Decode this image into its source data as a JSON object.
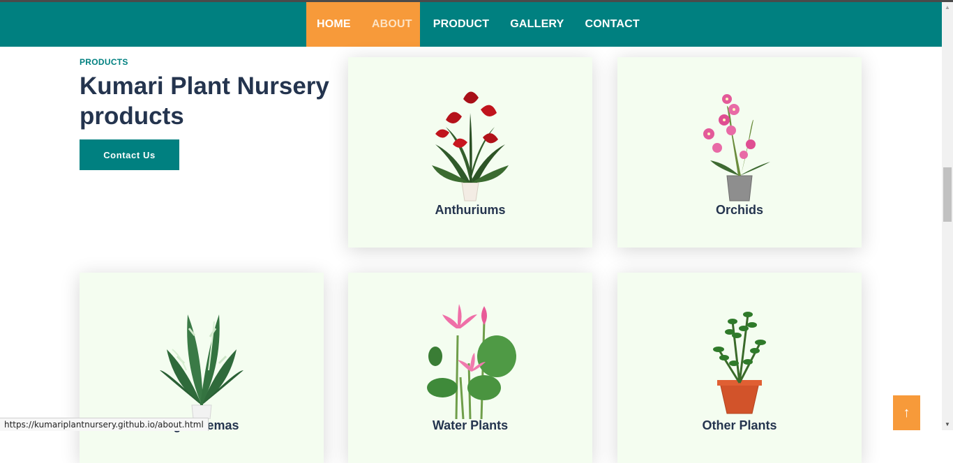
{
  "nav": {
    "items": [
      {
        "label": "HOME",
        "active": false
      },
      {
        "label": "ABOUT",
        "active": true
      },
      {
        "label": "PRODUCT",
        "active": false
      },
      {
        "label": "GALLERY",
        "active": false
      },
      {
        "label": "CONTACT",
        "active": false
      }
    ]
  },
  "section": {
    "eyebrow": "PRODUCTS",
    "heading": "Kumari Plant Nursery products",
    "cta_label": "Contact Us"
  },
  "products": [
    {
      "name": "Anthuriums",
      "icon": "anthurium-plant-image"
    },
    {
      "name": "Orchids",
      "icon": "orchid-plant-image"
    },
    {
      "name": "Aglaonemas",
      "icon": "aglaonema-plant-image"
    },
    {
      "name": "Water Plants",
      "icon": "lotus-plant-image"
    },
    {
      "name": "Other Plants",
      "icon": "potted-plant-image"
    }
  ],
  "status_url": "https://kumariplantnursery.github.io/about.html",
  "back_to_top_icon": "arrow-up-icon",
  "colors": {
    "brand": "#008080",
    "accent": "#f79a3a",
    "heading": "#24344e",
    "card_bg": "#f4fdf0"
  }
}
